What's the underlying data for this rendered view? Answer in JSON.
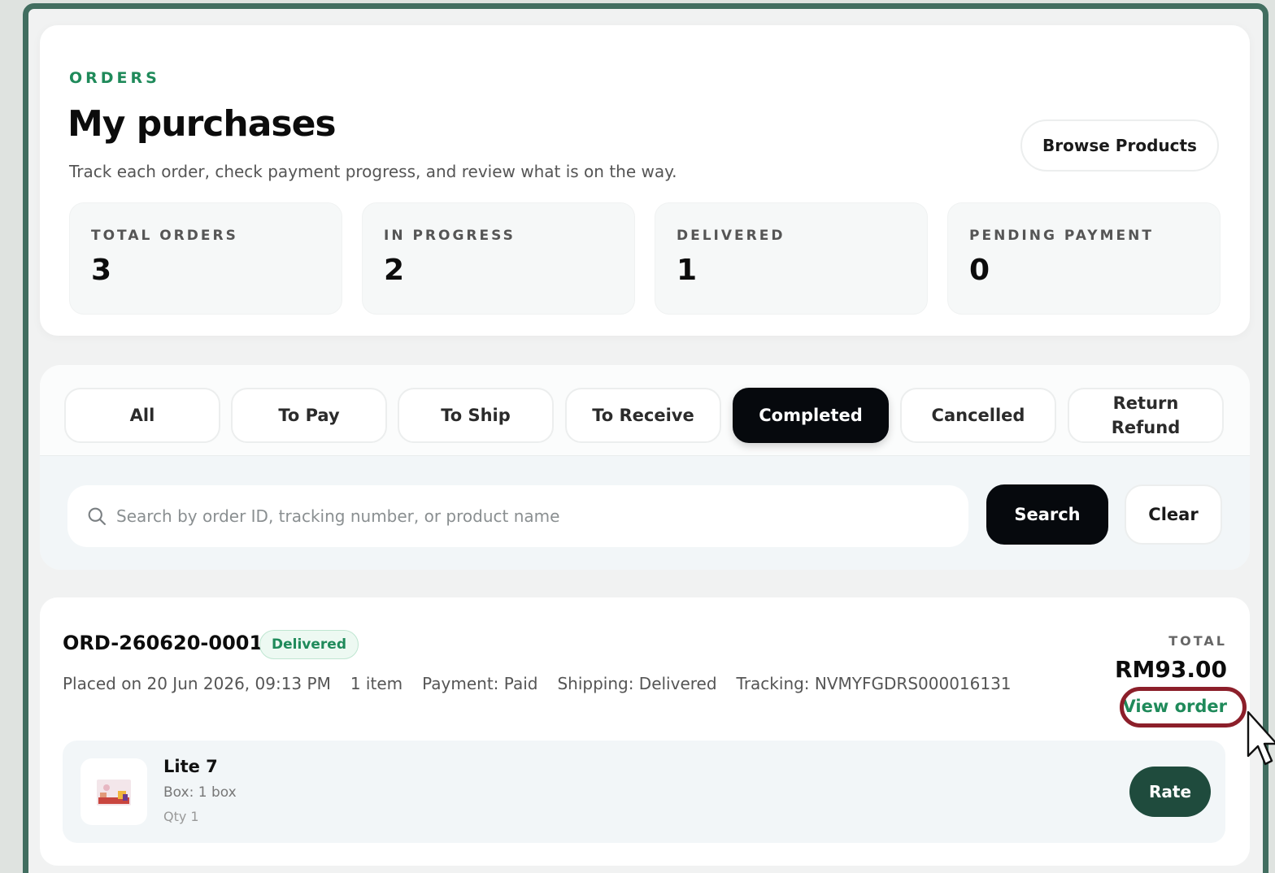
{
  "header": {
    "eyebrow": "ORDERS",
    "title": "My purchases",
    "subtitle": "Track each order, check payment progress, and review what is on the way.",
    "browse_label": "Browse Products"
  },
  "stats": [
    {
      "label": "TOTAL ORDERS",
      "value": "3"
    },
    {
      "label": "IN PROGRESS",
      "value": "2"
    },
    {
      "label": "DELIVERED",
      "value": "1"
    },
    {
      "label": "PENDING PAYMENT",
      "value": "0"
    }
  ],
  "tabs": [
    {
      "label": "All",
      "active": false
    },
    {
      "label": "To Pay",
      "active": false
    },
    {
      "label": "To Ship",
      "active": false
    },
    {
      "label": "To Receive",
      "active": false
    },
    {
      "label": "Completed",
      "active": true
    },
    {
      "label": "Cancelled",
      "active": false
    },
    {
      "label": "Return\nRefund",
      "active": false
    }
  ],
  "search": {
    "placeholder": "Search by order ID, tracking number, or product name",
    "value": "",
    "search_label": "Search",
    "clear_label": "Clear",
    "icon": "search-icon"
  },
  "order": {
    "id": "ORD-260620-0001",
    "status": "Delivered",
    "placed": "Placed on 20 Jun 2026, 09:13 PM",
    "items_count": "1 item",
    "payment": "Payment: Paid",
    "shipping": "Shipping: Delivered",
    "tracking": "Tracking: NVMYFGDRS000016131",
    "total_label": "TOTAL",
    "total_value": "RM93.00",
    "view_label": "View order",
    "item": {
      "name": "Lite 7",
      "variant": "Box: 1 box",
      "qty": "Qty 1",
      "rate_label": "Rate"
    }
  },
  "colors": {
    "accent_green": "#1f8a5a",
    "dark_green": "#1f4b3d",
    "frame_green": "#426e60",
    "active_tab": "#06090d",
    "highlight_ring": "#8c1f2a"
  }
}
